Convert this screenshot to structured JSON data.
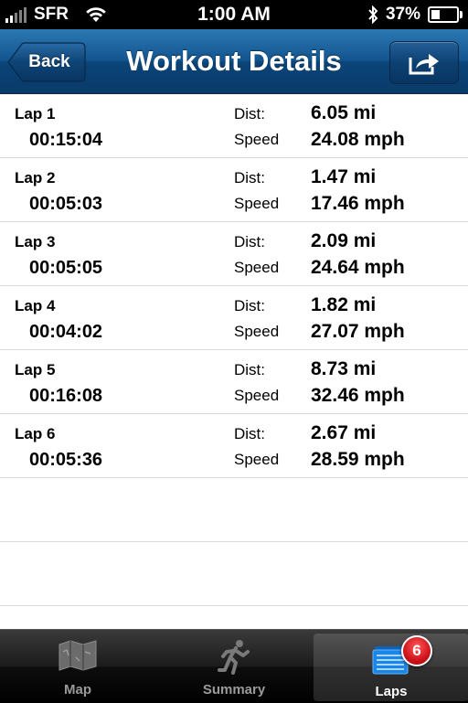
{
  "status_bar": {
    "carrier": "SFR",
    "time": "1:00 AM",
    "battery_percent": "37%",
    "battery_level": 0.37,
    "signal_icon": "signal-bars-icon",
    "wifi_icon": "wifi-icon",
    "bluetooth_icon": "bluetooth-icon"
  },
  "nav": {
    "back_label": "Back",
    "title": "Workout Details",
    "share_icon": "share-icon",
    "color": "#13558f"
  },
  "laps": [
    {
      "name": "Lap 1",
      "duration": "00:15:04",
      "dist_label": "Dist:",
      "dist": "6.05 mi",
      "speed_label": "Speed",
      "speed": "24.08 mph"
    },
    {
      "name": "Lap 2",
      "duration": "00:05:03",
      "dist_label": "Dist:",
      "dist": "1.47 mi",
      "speed_label": "Speed",
      "speed": "17.46 mph"
    },
    {
      "name": "Lap 3",
      "duration": "00:05:05",
      "dist_label": "Dist:",
      "dist": "2.09 mi",
      "speed_label": "Speed",
      "speed": "24.64 mph"
    },
    {
      "name": "Lap 4",
      "duration": "00:04:02",
      "dist_label": "Dist:",
      "dist": "1.82 mi",
      "speed_label": "Speed",
      "speed": "27.07 mph"
    },
    {
      "name": "Lap 5",
      "duration": "00:16:08",
      "dist_label": "Dist:",
      "dist": "8.73 mi",
      "speed_label": "Speed",
      "speed": "32.46 mph"
    },
    {
      "name": "Lap 6",
      "duration": "00:05:36",
      "dist_label": "Dist:",
      "dist": "2.67 mi",
      "speed_label": "Speed",
      "speed": "28.59 mph"
    }
  ],
  "tabs": [
    {
      "label": "Map",
      "icon": "map-icon",
      "active": false
    },
    {
      "label": "Summary",
      "icon": "runner-icon",
      "active": false
    },
    {
      "label": "Laps",
      "icon": "laps-icon",
      "active": true,
      "badge": "6"
    }
  ]
}
